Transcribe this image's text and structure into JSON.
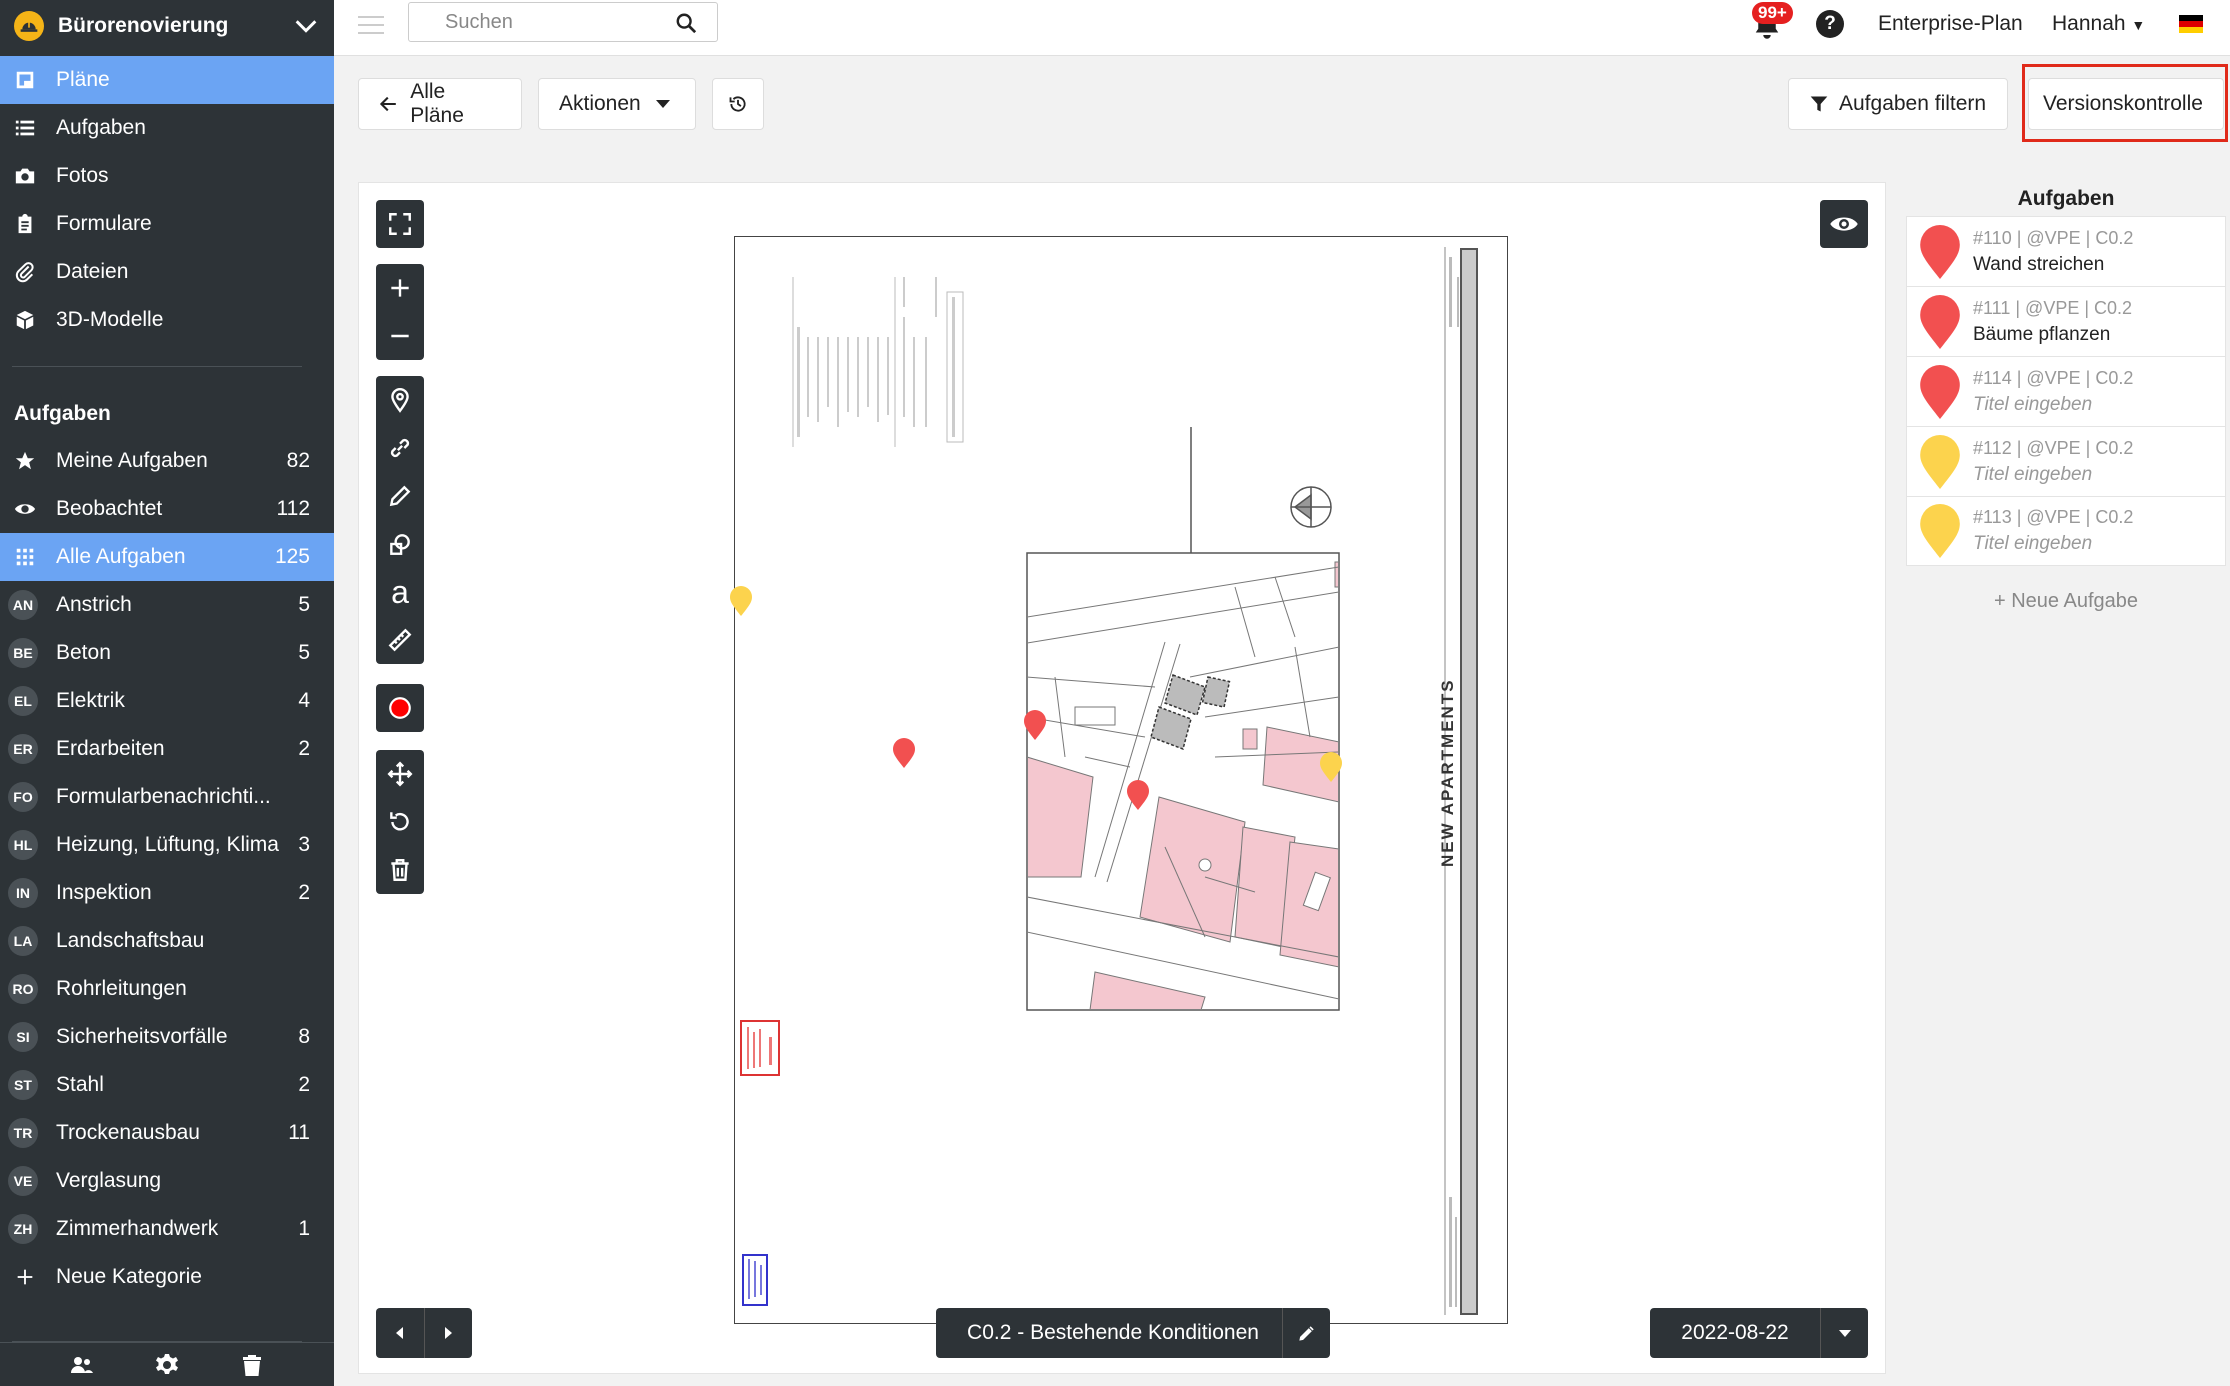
{
  "project": {
    "title": "Bürorenovierung"
  },
  "nav": [
    {
      "label": "Pläne",
      "icon": "plans-icon",
      "active": true
    },
    {
      "label": "Aufgaben",
      "icon": "list-icon"
    },
    {
      "label": "Fotos",
      "icon": "camera-icon"
    },
    {
      "label": "Formulare",
      "icon": "clipboard-icon"
    },
    {
      "label": "Dateien",
      "icon": "paperclip-icon"
    },
    {
      "label": "3D-Modelle",
      "icon": "cube-icon"
    }
  ],
  "tasks_section": {
    "title": "Aufgaben",
    "filters": [
      {
        "label": "Meine Aufgaben",
        "count": "82",
        "icon": "star-icon"
      },
      {
        "label": "Beobachtet",
        "count": "112",
        "icon": "eye-icon"
      },
      {
        "label": "Alle Aufgaben",
        "count": "125",
        "icon": "grid-icon",
        "active": true
      }
    ],
    "categories": [
      {
        "badge": "AN",
        "label": "Anstrich",
        "count": "5"
      },
      {
        "badge": "BE",
        "label": "Beton",
        "count": "5"
      },
      {
        "badge": "EL",
        "label": "Elektrik",
        "count": "4"
      },
      {
        "badge": "ER",
        "label": "Erdarbeiten",
        "count": "2"
      },
      {
        "badge": "FO",
        "label": "Formularbenachrichti...",
        "count": ""
      },
      {
        "badge": "HL",
        "label": "Heizung, Lüftung, Klima",
        "count": "3"
      },
      {
        "badge": "IN",
        "label": "Inspektion",
        "count": "2"
      },
      {
        "badge": "LA",
        "label": "Landschaftsbau",
        "count": ""
      },
      {
        "badge": "RO",
        "label": "Rohrleitungen",
        "count": ""
      },
      {
        "badge": "SI",
        "label": "Sicherheitsvorfälle",
        "count": "8"
      },
      {
        "badge": "ST",
        "label": "Stahl",
        "count": "2"
      },
      {
        "badge": "TR",
        "label": "Trockenausbau",
        "count": "11"
      },
      {
        "badge": "VE",
        "label": "Verglasung",
        "count": ""
      },
      {
        "badge": "ZH",
        "label": "Zimmerhandwerk",
        "count": "1"
      }
    ],
    "new_category": "Neue Kategorie"
  },
  "topbar": {
    "search_placeholder": "Suchen",
    "notifications": "99+",
    "help": "?",
    "plan": "Enterprise-Plan",
    "user": "Hannah"
  },
  "toolbar": {
    "back": "Alle Pläne",
    "actions": "Aktionen",
    "filter": "Aufgaben filtern",
    "version": "Versionskontrolle"
  },
  "viewer": {
    "sheet_name": "C0.2 - Bestehende Konditionen",
    "date": "2022-08-22",
    "drawing_title": "NEW APARTMENTS"
  },
  "task_panel": {
    "title": "Aufgaben",
    "tasks": [
      {
        "meta": "#110 | @VPE | C0.2",
        "title": "Wand streichen",
        "color": "#f25050",
        "placeholder": false
      },
      {
        "meta": "#111 | @VPE | C0.2",
        "title": "Bäume pflanzen",
        "color": "#f25050",
        "placeholder": false
      },
      {
        "meta": "#114 | @VPE | C0.2",
        "title": "Titel eingeben",
        "color": "#f25050",
        "placeholder": true
      },
      {
        "meta": "#112 | @VPE | C0.2",
        "title": "Titel eingeben",
        "color": "#fcd34d",
        "placeholder": true
      },
      {
        "meta": "#113 | @VPE | C0.2",
        "title": "Titel eingeben",
        "color": "#fcd34d",
        "placeholder": true
      }
    ],
    "new_task": "+ Neue Aufgabe"
  },
  "colors": {
    "accent": "#6ba4f3",
    "sidebar": "#2d3337",
    "highlight": "#e02a1a",
    "pin_red": "#f25050",
    "pin_yellow": "#fcd34d"
  }
}
